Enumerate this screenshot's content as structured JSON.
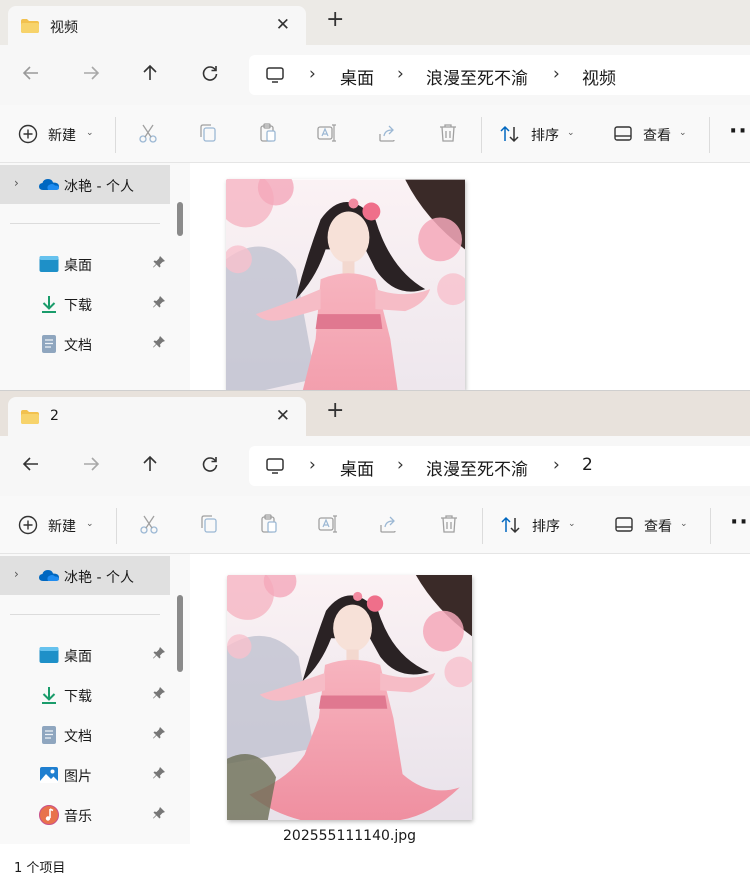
{
  "windows": [
    {
      "tab": {
        "title": "视频",
        "close_glyph": "✕",
        "new_tab_glyph": "+"
      },
      "breadcrumb": [
        "桌面",
        "浪漫至死不渝",
        "视频"
      ],
      "toolbar": {
        "new_label": "新建",
        "sort_label": "排序",
        "view_label": "查看",
        "more_glyph": "···"
      },
      "sidebar": {
        "cloud_label": "冰艳 - 个人",
        "items": [
          {
            "label": "桌面",
            "icon": "desktop-icon"
          },
          {
            "label": "下载",
            "icon": "download-icon"
          },
          {
            "label": "文档",
            "icon": "document-icon"
          }
        ]
      }
    },
    {
      "tab": {
        "title": "2",
        "close_glyph": "✕",
        "new_tab_glyph": "+"
      },
      "breadcrumb": [
        "桌面",
        "浪漫至死不渝",
        "2"
      ],
      "toolbar": {
        "new_label": "新建",
        "sort_label": "排序",
        "view_label": "查看",
        "more_glyph": "···"
      },
      "sidebar": {
        "cloud_label": "冰艳 - 个人",
        "items": [
          {
            "label": "桌面",
            "icon": "desktop-icon"
          },
          {
            "label": "下载",
            "icon": "download-icon"
          },
          {
            "label": "文档",
            "icon": "document-icon"
          },
          {
            "label": "图片",
            "icon": "pictures-icon"
          },
          {
            "label": "音乐",
            "icon": "music-icon"
          }
        ]
      },
      "file": {
        "name": "202555111140.jpg"
      },
      "status": "1 个项目"
    }
  ],
  "colors": {
    "accent": "#0067c0",
    "selection": "#e0e0e0",
    "folder": "#f2c14e"
  }
}
